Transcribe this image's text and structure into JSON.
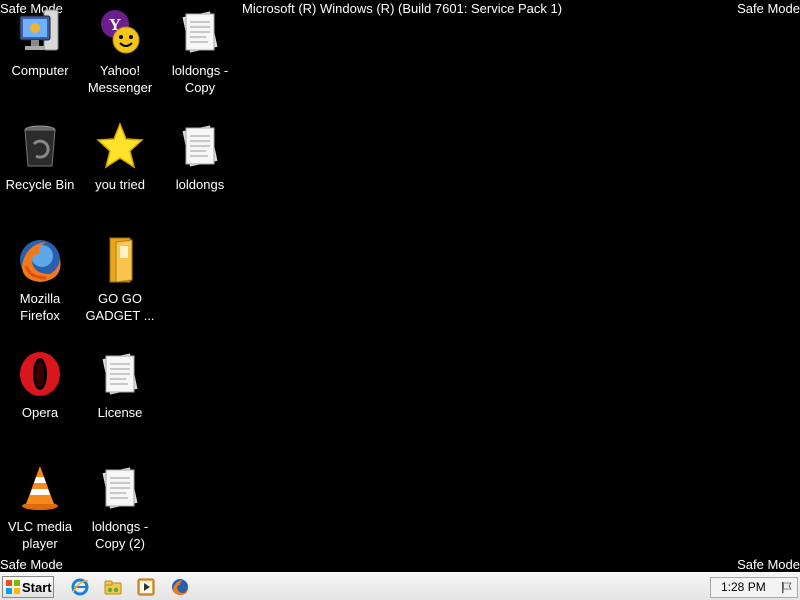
{
  "overlay": {
    "corner_text": "Safe Mode",
    "build_text": "Microsoft (R) Windows (R) (Build 7601: Service Pack 1)"
  },
  "desktop": {
    "icons": [
      {
        "label": "Computer",
        "icon": "computer-icon"
      },
      {
        "label": "Yahoo! Messenger",
        "icon": "yahoo-messenger-icon"
      },
      {
        "label": "loldongs - Copy",
        "icon": "text-document-icon"
      },
      {
        "label": "Recycle Bin",
        "icon": "recycle-bin-icon"
      },
      {
        "label": "you tried",
        "icon": "star-icon"
      },
      {
        "label": "loldongs",
        "icon": "text-document-icon"
      },
      {
        "label": "Mozilla Firefox",
        "icon": "firefox-icon"
      },
      {
        "label": "GO GO GADGET ...",
        "icon": "folder-icon"
      },
      {
        "label": "Opera",
        "icon": "opera-icon"
      },
      {
        "label": "License",
        "icon": "text-document-icon"
      },
      {
        "label": "VLC media player",
        "icon": "vlc-icon"
      },
      {
        "label": "loldongs - Copy (2)",
        "icon": "text-document-icon"
      }
    ]
  },
  "taskbar": {
    "start_label": "Start",
    "quick_launch": [
      "internet-explorer-icon",
      "explorer-folder-icon",
      "media-player-icon",
      "firefox-icon"
    ],
    "clock": "1:28 PM",
    "tray_icon": "action-center-flag-icon"
  },
  "colors": {
    "desktop_background": "#000000",
    "overlay_text": "#ffffff",
    "taskbar": "#ececec"
  }
}
